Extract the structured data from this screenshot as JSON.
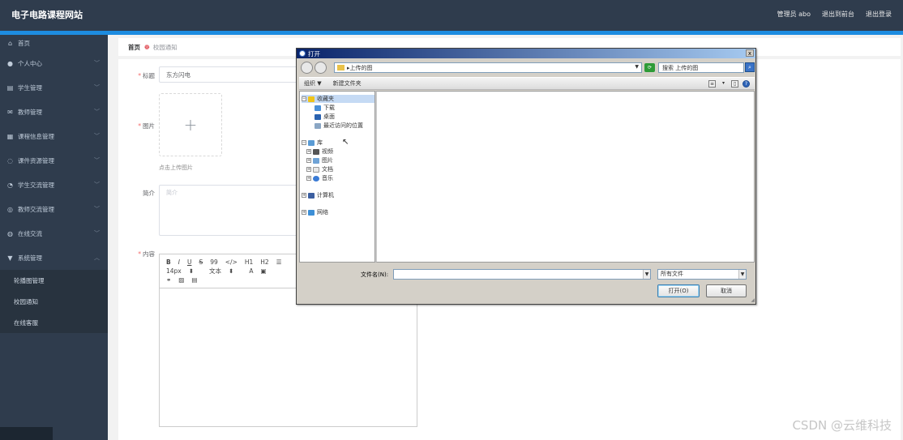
{
  "header": {
    "title": "电子电路课程网站",
    "user": "管理员 abo",
    "back_to_front": "退出到前台",
    "logout": "退出登录"
  },
  "sidebar": {
    "items": [
      {
        "label": "首页",
        "icon": "home-icon"
      },
      {
        "label": "个人中心",
        "icon": "user-icon"
      },
      {
        "label": "学生管理",
        "icon": "student-icon"
      },
      {
        "label": "教师管理",
        "icon": "teacher-icon"
      },
      {
        "label": "课程信息管理",
        "icon": "course-icon"
      },
      {
        "label": "课件资源管理",
        "icon": "resource-icon"
      },
      {
        "label": "学生交流管理",
        "icon": "chat-icon"
      },
      {
        "label": "教师交流管理",
        "icon": "discussion-icon"
      },
      {
        "label": "在线交流",
        "icon": "online-icon"
      },
      {
        "label": "系统管理",
        "icon": "system-icon"
      }
    ],
    "subitems": [
      "轮播图管理",
      "校园通知",
      "在线客服"
    ]
  },
  "breadcrumb": {
    "home": "首页",
    "current": "校园通知"
  },
  "form": {
    "title_label": "标题",
    "title_value": "东方闪电",
    "image_label": "图片",
    "upload_plus": "+",
    "upload_hint": "点击上传图片",
    "intro_label": "简介",
    "intro_placeholder": "简介",
    "content_label": "内容",
    "editor_row1": [
      "B",
      "I",
      "U",
      "S",
      "99",
      "</>",
      "H1",
      "H2",
      "☰",
      "☰"
    ],
    "editor_font_size": "14px",
    "editor_font_type": "文本"
  },
  "dialog": {
    "title": "打开",
    "close": "x",
    "address": "上传的图",
    "search_placeholder": "搜索 上传的图",
    "organize": "组织 ▼",
    "new_folder": "新建文件夹",
    "nav": {
      "favorites": "收藏夹",
      "downloads": "下载",
      "desktop": "桌面",
      "recent": "最近访问的位置",
      "libraries": "库",
      "videos": "视频",
      "pictures": "图片",
      "documents": "文档",
      "music": "音乐",
      "computer": "计算机",
      "network": "网络"
    },
    "filename_label": "文件名(N):",
    "filename_value": "",
    "filetype": "所有文件",
    "open_button": "打开(O)",
    "cancel_button": "取消"
  },
  "watermark": "CSDN @云维科技",
  "colors": {
    "header_bg": "#2f3c4d",
    "accent": "#1d8ce0",
    "required": "#f56c6c"
  }
}
